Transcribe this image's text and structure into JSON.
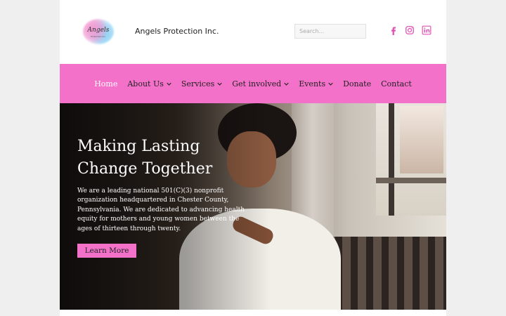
{
  "brand": {
    "logo_text": "Angels",
    "logo_subtext": "Protection Inc.",
    "site_title": "Angels Protection Inc."
  },
  "search": {
    "placeholder": "Search..."
  },
  "social": [
    {
      "icon": "facebook-icon",
      "color": "#e052b4"
    },
    {
      "icon": "instagram-icon",
      "color": "#e052b4"
    },
    {
      "icon": "linkedin-icon",
      "color": "#e052b4"
    }
  ],
  "nav": {
    "bg_color": "#f471c9",
    "items": [
      {
        "label": "Home",
        "active": true
      },
      {
        "label": "About Us",
        "dropdown": true
      },
      {
        "label": "Services",
        "dropdown": true
      },
      {
        "label": "Get involved",
        "dropdown": true
      },
      {
        "label": "Events",
        "dropdown": true
      },
      {
        "label": "Donate"
      },
      {
        "label": "Contact"
      }
    ]
  },
  "hero": {
    "title_line1": "Making Lasting",
    "title_line2": "Change Together",
    "text": "We are a leading national 501(C)(3) nonprofit organization headquartered in Chester County, Pennsylvania. We are dedicated to advancing health equity for mothers and young women between the ages of thirteen through twenty.",
    "button_label": "Learn More",
    "button_color": "#f471c9"
  }
}
